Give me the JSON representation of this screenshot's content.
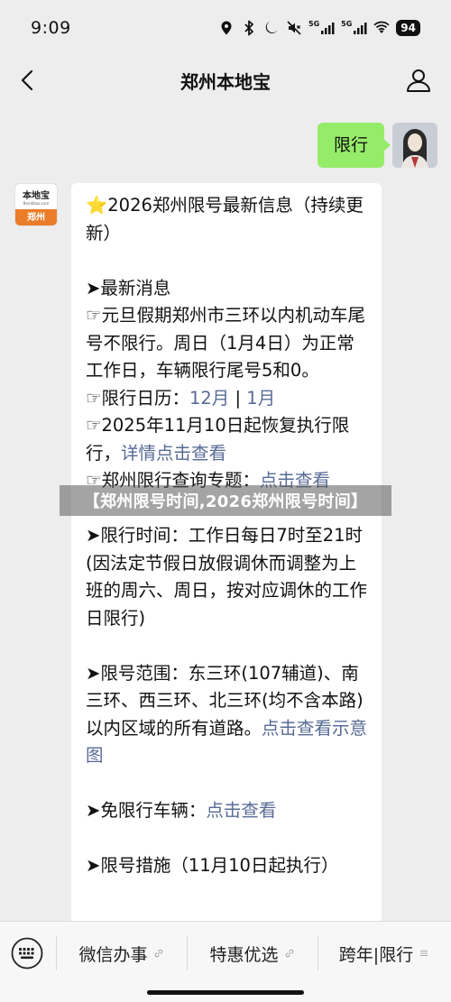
{
  "status": {
    "time": "9:09",
    "signal1": "5G",
    "signal2": "5G",
    "battery": "94",
    "icons": [
      "location-icon",
      "bluetooth-icon",
      "moon-icon",
      "mute-icon",
      "signal-icon",
      "signal-icon",
      "wifi-icon",
      "battery-icon"
    ]
  },
  "nav": {
    "title": "郑州本地宝",
    "back_icon": "chevron-left-icon",
    "profile_icon": "person-icon"
  },
  "chat": {
    "outgoing": {
      "text": "限行"
    },
    "incoming": {
      "avatar_top": "本地宝",
      "avatar_sub": "Bendibao.com",
      "avatar_bottom": "郑州",
      "lines": [
        "⭐2026郑州限号最新信息（持续更新）",
        "➤最新消息",
        "☞元旦假期郑州市三环以内机动车尾号不限行。周日（1月4日）为正常工作日，车辆限行尾号5和0。",
        "☞限行日历：",
        "12月",
        "|",
        "1月",
        "☞2025年11月10日起恢复执行限行，",
        "详情点击查看",
        "☞郑州限行查询专题：",
        "点击查看",
        "➤限行时间：工作日每日7时至21时(因法定节假日放假调休而调整为上班的周六、周日，按对应调休的工作日限行)",
        "➤限号范围：东三环(107辅道)、南三环、西三环、北三环(均不含本路)以内区域的所有道路。",
        "点击查看示意图",
        "➤免限行车辆：",
        "点击查看",
        "➤限号措施（11月10日起执行）"
      ]
    }
  },
  "banner": {
    "text": "【郑州限号时间,2026郑州限号时间】"
  },
  "bottom_menu": {
    "keyboard_icon": "keyboard-icon",
    "items": [
      {
        "label": "微信办事"
      },
      {
        "label": "特惠优选"
      },
      {
        "label": "跨年|限行"
      }
    ]
  }
}
